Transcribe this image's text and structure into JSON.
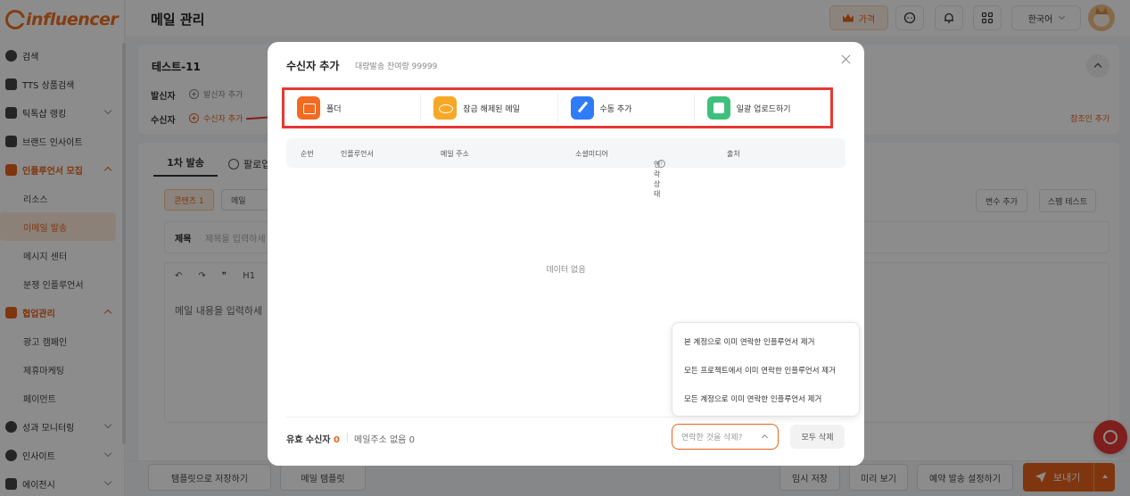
{
  "brand": {
    "logo_text": "influencer"
  },
  "sidebar": {
    "items": [
      {
        "label": "검색"
      },
      {
        "label": "TTS 상품검색"
      },
      {
        "label": "틱톡샵 랭킹"
      },
      {
        "label": "브랜드 인사이트"
      },
      {
        "label": "인플루언서 모집"
      },
      {
        "label": "리소스"
      },
      {
        "label": "이메일 발송"
      },
      {
        "label": "메시지 센터"
      },
      {
        "label": "분쟁 인플루언서"
      },
      {
        "label": "협업관리"
      },
      {
        "label": "광고 캠페인"
      },
      {
        "label": "제휴마케팅"
      },
      {
        "label": "페이먼트"
      },
      {
        "label": "성과 모니터링"
      },
      {
        "label": "인사이트"
      },
      {
        "label": "에이전시"
      }
    ]
  },
  "header": {
    "title": "메일 관리",
    "price_label": "가격",
    "language": "한국어"
  },
  "background": {
    "project_title": "테스트-11",
    "sender_label": "발신자",
    "add_sender": "발신자 추가",
    "recipient_label": "수신자",
    "add_recipient": "수신자 추가",
    "ref_add": "참조인 추가",
    "tab_first": "1차 발송",
    "tab_follow": "팔로업",
    "content_tab": "콘텐츠 1",
    "mail_tab": "메일",
    "subject_label": "제목",
    "subject_placeholder": "제목을 입력하세",
    "editor_toolbar": [
      "↶",
      "↷",
      "❞",
      "H1"
    ],
    "editor_placeholder": "메일 내용을 입력하세",
    "add_variable": "변수 추가",
    "spam_test": "스팸 테스트",
    "save_template": "템플릿으로 저장하기",
    "mail_template": "메일 템플릿",
    "temp_save": "임시 저장",
    "preview": "미리 보기",
    "schedule": "예약 발송 설정하기",
    "send": "보내기"
  },
  "modal": {
    "title": "수신자 추가",
    "subtitle": "대량발송 잔여량 99999",
    "sources": [
      {
        "label": "폴더",
        "icon": "folder-icon",
        "color": "#f26b21"
      },
      {
        "label": "잠금 해제된 메일",
        "icon": "eye-icon",
        "color": "#f9a825"
      },
      {
        "label": "수동 추가",
        "icon": "pen-icon",
        "color": "#2f7cf6"
      },
      {
        "label": "일괄 업로드하기",
        "icon": "upload-icon",
        "color": "#3ec07c"
      }
    ],
    "table_headers": {
      "index": "순번",
      "influencer": "인플루언서",
      "email": "메일 주소",
      "social": "소셜미디어",
      "contact_status": "연락상태",
      "source": "출처"
    },
    "empty_text": "데이터 없음",
    "valid_label": "유효 수신자",
    "valid_count": "0",
    "no_email_label": "메일주소 없음",
    "no_email_count": "0",
    "delete_placeholder": "연락한 것을 삭제?",
    "delete_all": "모두 삭제",
    "dropdown_options": [
      "본 계정으로 이미 연락한 인플루언서 제거",
      "모든 프로젝트에서 이미 연락한 인플루언서 제거",
      "모든 계정으로 이미 연락한 인플루언서 제거"
    ]
  }
}
